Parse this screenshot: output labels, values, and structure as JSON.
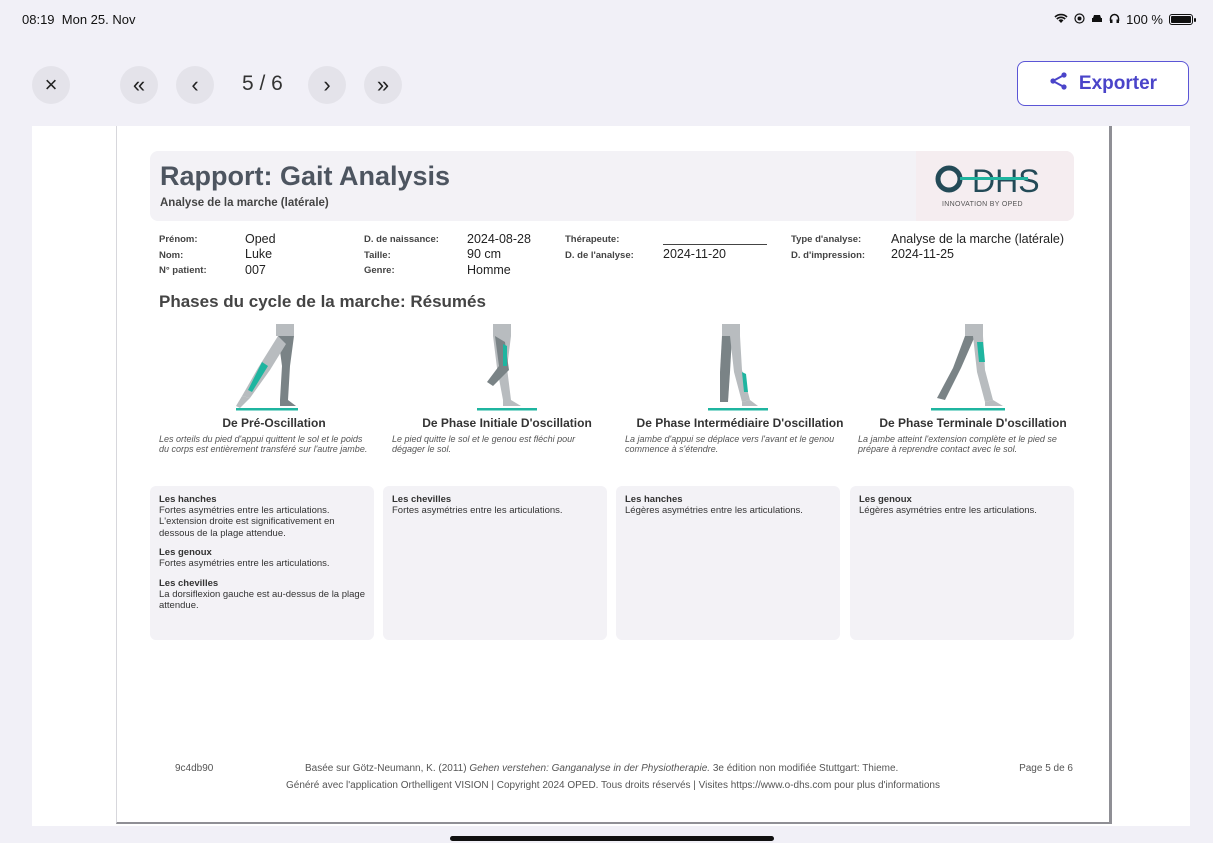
{
  "status": {
    "time": "08:19",
    "date": "Mon 25. Nov",
    "battery": "100 %",
    "battery_level": 1.0
  },
  "toolbar": {
    "close_glyph": "×",
    "first_glyph": "«",
    "prev_glyph": "‹",
    "page": "5 / 6",
    "next_glyph": "›",
    "last_glyph": "»",
    "export_label": "Exporter"
  },
  "report": {
    "title": "Rapport: Gait Analysis",
    "subtitle": "Analyse de la marche (latérale)",
    "logo": {
      "name": "O-DHS",
      "tagline": "INNOVATION BY OPED"
    },
    "patient": {
      "prenom_label": "Prénom:",
      "prenom": "Oped",
      "nom_label": "Nom:",
      "nom": "Luke",
      "num_label": "N° patient:",
      "num": "007",
      "naissance_label": "D. de naissance:",
      "naissance": "2024-08-28",
      "taille_label": "Taille:",
      "taille": "90 cm",
      "genre_label": "Genre:",
      "genre": "Homme",
      "therapeute_label": "Thérapeute:",
      "analyse_date_label": "D. de l'analyse:",
      "analyse_date": "2024-11-20",
      "type_label": "Type d'analyse:",
      "type": "Analyse de la marche (latérale)",
      "impression_label": "D. d'impression:",
      "impression": "2024-11-25"
    },
    "section_title": "Phases du cycle de la marche: Résumés",
    "phases": [
      {
        "title": "De Pré-Oscillation",
        "desc": "Les orteils du pied d'appui quittent le sol et le poids du corps est entièrement transféré sur l'autre jambe."
      },
      {
        "title": "De Phase Initiale D'oscillation",
        "desc": "Le pied quitte le sol et le genou est fléchi pour dégager le sol."
      },
      {
        "title": "De Phase Intermédiaire D'oscillation",
        "desc": "La jambe d'appui se déplace vers l'avant et le genou commence à s'étendre."
      },
      {
        "title": "De Phase Terminale D'oscillation",
        "desc": "La jambe atteint l'extension complète et le pied se prépare à reprendre contact avec le sol."
      }
    ],
    "boxes": [
      [
        {
          "h": "Les hanches",
          "t": "Fortes asymétries entre les articulations. L'extension droite est significativement en dessous de la plage attendue."
        },
        {
          "h": "Les genoux",
          "t": "Fortes asymétries entre les articulations."
        },
        {
          "h": "Les chevilles",
          "t": "La dorsiflexion gauche est au-dessus de la plage attendue."
        }
      ],
      [
        {
          "h": "Les chevilles",
          "t": "Fortes asymétries entre les articulations."
        }
      ],
      [
        {
          "h": "Les hanches",
          "t": "Légères asymétries entre les articulations."
        }
      ],
      [
        {
          "h": "Les genoux",
          "t": "Légères asymétries entre les articulations."
        }
      ]
    ],
    "footer": {
      "id": "9c4db90",
      "ref_pre": "Basée sur Götz-Neumann, K. (2011) ",
      "ref_italic": "Gehen verstehen: Ganganalyse in der Physiotherapie.",
      "ref_post": " 3e édition non modifiée Stuttgart: Thieme.",
      "page": "Page 5 de 6",
      "copyright": "Généré avec l'application Orthelligent VISION | Copyright 2024 OPED. Tous droits réservés | Visites https://www.o-dhs.com pour plus d'informations"
    }
  },
  "colors": {
    "accent": "#4a44c9",
    "teal": "#1fb5a0",
    "leg_gray": "#b8bcbf",
    "leg_dark": "#7a8386"
  }
}
